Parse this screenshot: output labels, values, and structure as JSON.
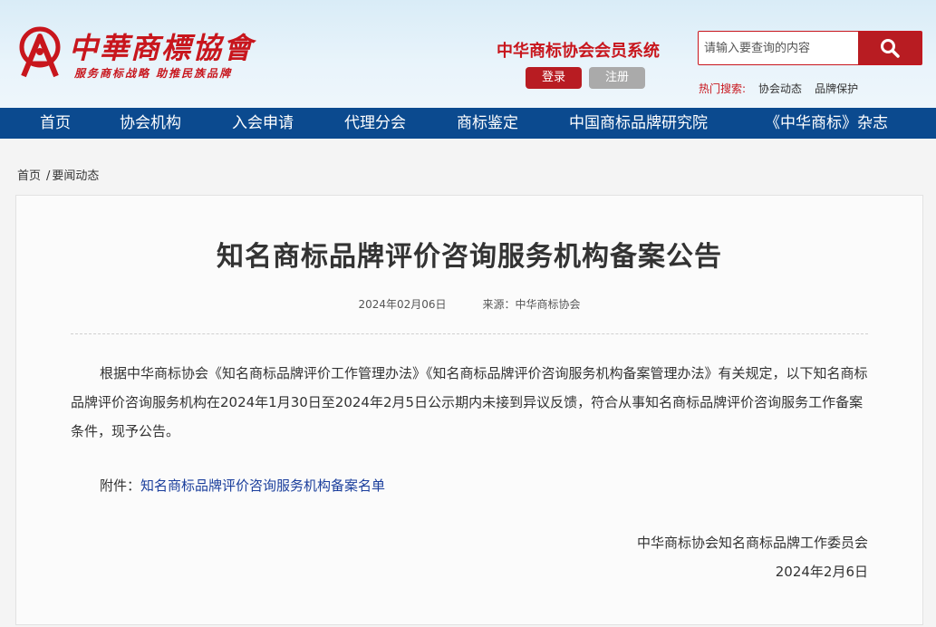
{
  "header": {
    "logo_title": "中華商標協會",
    "logo_slogan": "服务商标战略  助推民族品牌",
    "system_title": "中华商标协会会员系统",
    "login_label": "登录",
    "register_label": "注册",
    "search_placeholder": "请输入要查询的内容",
    "hot_label": "热门搜索:",
    "hot_links": [
      "协会动态",
      "品牌保护"
    ]
  },
  "nav": {
    "items": [
      "首页",
      "协会机构",
      "入会申请",
      "代理分会",
      "商标鉴定",
      "中国商标品牌研究院",
      "《中华商标》杂志"
    ]
  },
  "breadcrumb": {
    "home": "首页",
    "separator": "/",
    "current": "要闻动态"
  },
  "article": {
    "title": "知名商标品牌评价咨询服务机构备案公告",
    "date": "2024年02月06日",
    "source": "来源：中华商标协会",
    "body": "根据中华商标协会《知名商标品牌评价工作管理办法》《知名商标品牌评价咨询服务机构备案管理办法》有关规定，以下知名商标品牌评价咨询服务机构在2024年1月30日至2024年2月5日公示期内未接到异议反馈，符合从事知名商标品牌评价咨询服务工作备案条件，现予公告。",
    "attachment_prefix": "附件：",
    "attachment_link": "知名商标品牌评价咨询服务机构备案名单",
    "signature": "中华商标协会知名商标品牌工作委员会",
    "sign_date": "2024年2月6日"
  },
  "colors": {
    "brand_red": "#c8161d",
    "nav_blue": "#0b4a8f",
    "link_blue": "#1a3e9c"
  },
  "icons": {
    "search": "search-icon",
    "logo": "association-logo-icon"
  }
}
